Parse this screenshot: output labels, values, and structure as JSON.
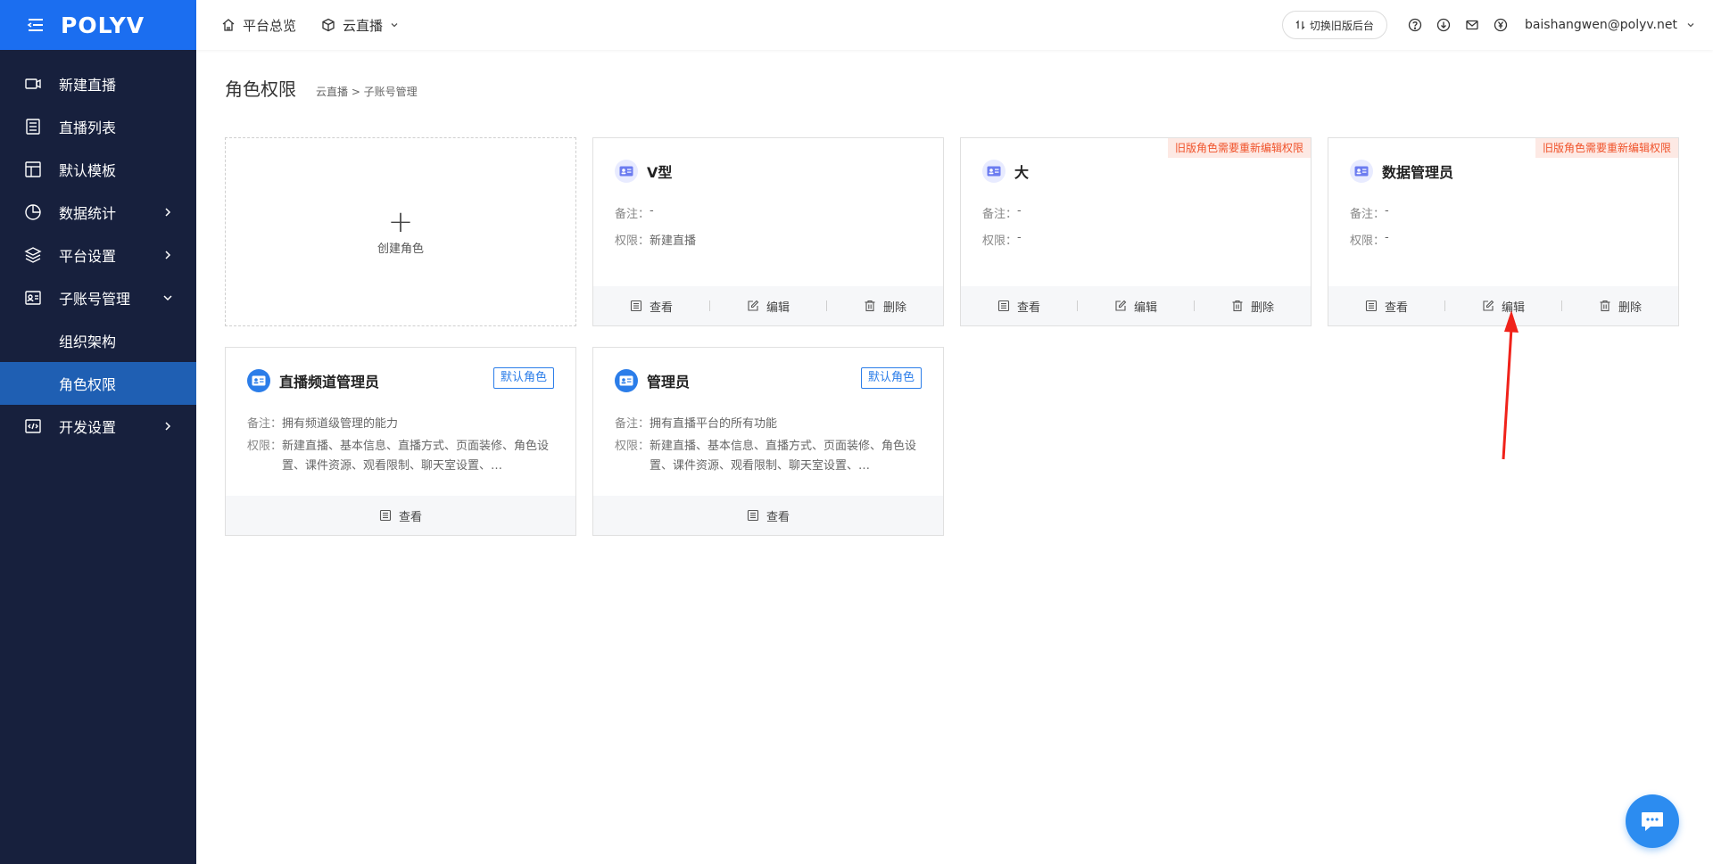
{
  "brand": {
    "logo_text": "POLYV"
  },
  "sidebar": {
    "items": [
      {
        "label": "新建直播",
        "icon": "video-camera-icon"
      },
      {
        "label": "直播列表",
        "icon": "list-icon"
      },
      {
        "label": "默认模板",
        "icon": "layout-template-icon"
      },
      {
        "label": "数据统计",
        "icon": "pie-chart-icon"
      },
      {
        "label": "平台设置",
        "icon": "layers-icon"
      },
      {
        "label": "子账号管理",
        "icon": "id-card-icon"
      },
      {
        "label": "组织架构"
      },
      {
        "label": "角色权限"
      },
      {
        "label": "开发设置",
        "icon": "code-icon"
      }
    ]
  },
  "topbar": {
    "home_label": "平台总览",
    "product_label": "云直播",
    "switch_label": "切换旧版后台",
    "user_email": "baishangwen@polyv.net"
  },
  "page": {
    "title": "角色权限",
    "breadcrumb": "云直播 >  子账号管理"
  },
  "create_card": {
    "label": "创建角色"
  },
  "labels": {
    "remark": "备注：",
    "permission": "权限：",
    "view": "查看",
    "edit": "编辑",
    "delete": "删除"
  },
  "cards": [
    {
      "name": "V型",
      "remark": "-",
      "permission": "新建直播",
      "badge": ""
    },
    {
      "name": "大",
      "remark": "-",
      "permission": "-",
      "badge": "旧版角色需要重新编辑权限"
    },
    {
      "name": "数据管理员",
      "remark": "-",
      "permission": "-",
      "badge": "旧版角色需要重新编辑权限"
    },
    {
      "name": "直播频道管理员",
      "remark": "拥有频道级管理的能力",
      "permission": "新建直播、基本信息、直播方式、页面装修、角色设置、课件资源、观看限制、聊天室设置、…",
      "badge": "默认角色"
    },
    {
      "name": "管理员",
      "remark": "拥有直播平台的所有功能",
      "permission": "新建直播、基本信息、直播方式、页面装修、角色设置、课件资源、观看限制、聊天室设置、…",
      "badge": "默认角色"
    }
  ],
  "colors": {
    "sidebar_bg": "#17203d",
    "brand_blue": "#1b6ef0",
    "active_item": "#1f5fb3",
    "warning_badge": "#f0522a",
    "default_badge": "#2b7de9"
  }
}
